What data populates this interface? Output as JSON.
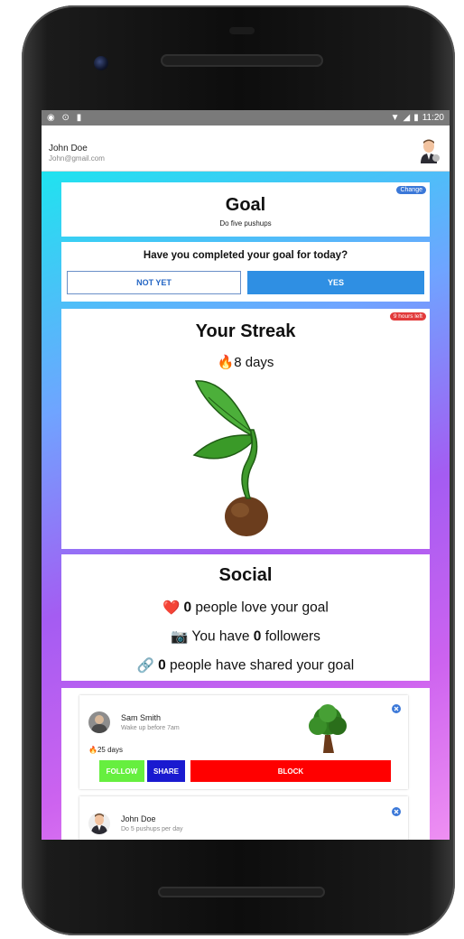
{
  "status_bar": {
    "time": "11:20"
  },
  "user": {
    "name": "John Doe",
    "email": "John@gmail.com"
  },
  "goal_card": {
    "title": "Goal",
    "description": "Do five pushups",
    "change_label": "Change"
  },
  "question_card": {
    "question": "Have you completed your goal for today?",
    "not_yet_label": "NOT YET",
    "yes_label": "YES"
  },
  "streak_card": {
    "title": "Your Streak",
    "days_text": "8 days",
    "badge": "9 hours left"
  },
  "social_card": {
    "title": "Social",
    "love": {
      "count": "0",
      "text": " people love your goal"
    },
    "followers": {
      "prefix": "You have ",
      "count": "0",
      "suffix": " followers"
    },
    "shared": {
      "count": "0",
      "text": " people have shared your goal"
    }
  },
  "feed": [
    {
      "name": "Sam Smith",
      "goal": "Wake up before 7am",
      "streak": "25 days",
      "follow_label": "FOLLOW",
      "share_label": "SHARE",
      "block_label": "BLOCK"
    },
    {
      "name": "John Doe",
      "goal": "Do 5 pushups per day"
    }
  ],
  "colors": {
    "primary_blue": "#2f8fe3",
    "follow_green": "#66ef3f",
    "share_blue": "#1a1ad0",
    "block_red": "#ff0000",
    "badge_red": "#e23b3b",
    "change_blue": "#3b78d8"
  },
  "icons": [
    "fire-icon",
    "heart-icon",
    "camera-icon",
    "link-icon",
    "close-icon",
    "sprout-icon",
    "tree-icon",
    "wifi-icon",
    "signal-icon",
    "battery-icon"
  ]
}
